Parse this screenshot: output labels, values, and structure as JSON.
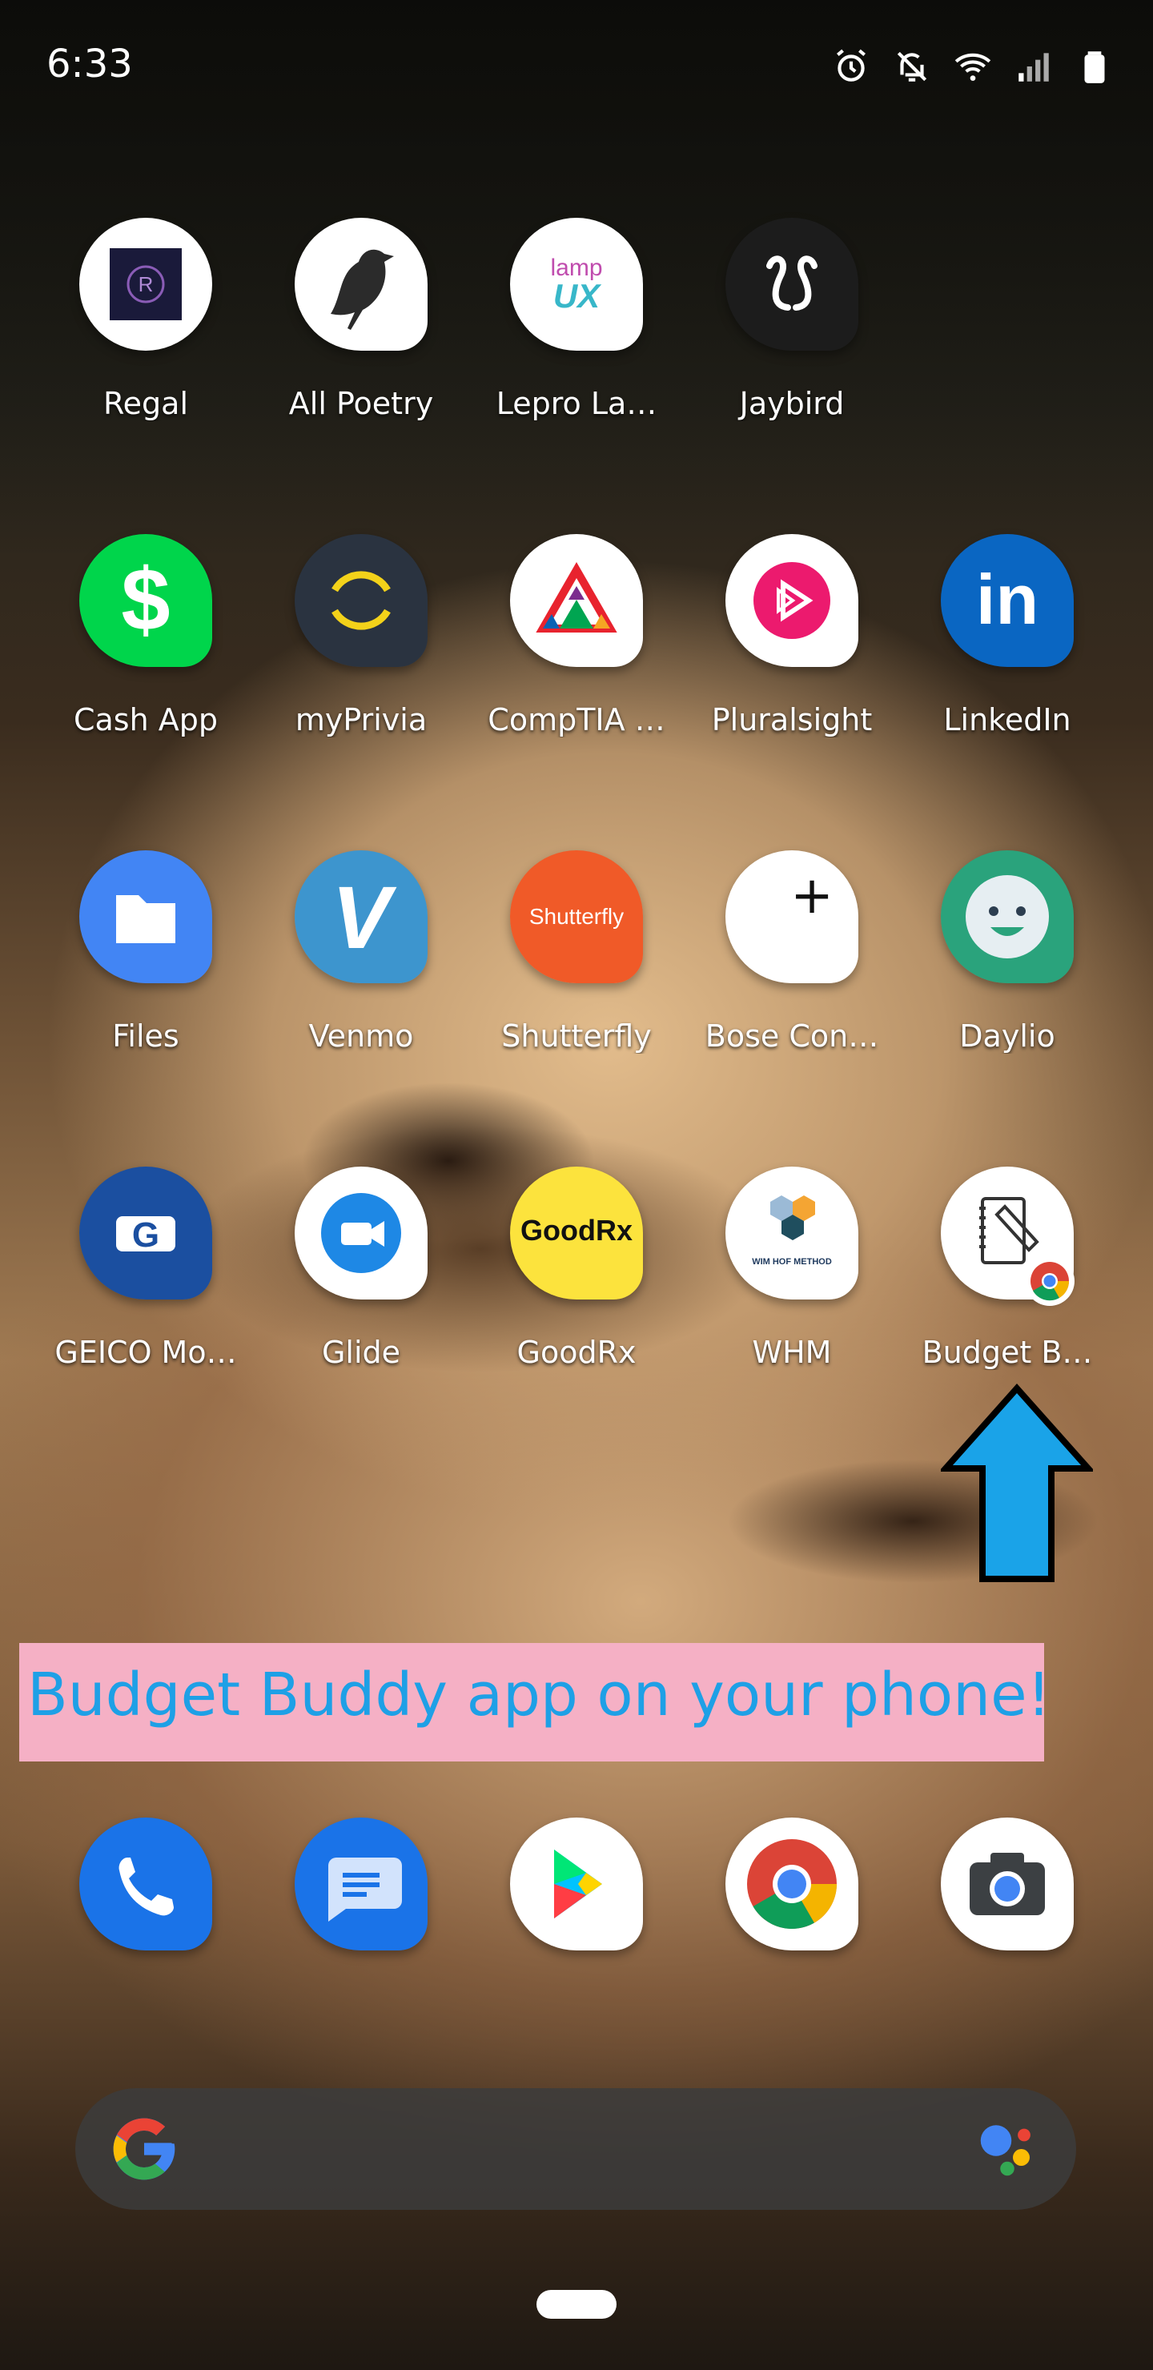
{
  "status_bar": {
    "time": "6:33",
    "icons": [
      "alarm-icon",
      "notifications-off-icon",
      "wifi-icon",
      "signal-icon",
      "battery-icon"
    ]
  },
  "apps": {
    "regal": "Regal",
    "all_poetry": "All Poetry",
    "lepro": "Lepro La…",
    "jaybird": "Jaybird",
    "cash_app": "Cash App",
    "myprivia": "myPrivia",
    "comptia": "CompTIA …",
    "pluralsight": "Pluralsight",
    "linkedin": "LinkedIn",
    "files": "Files",
    "venmo": "Venmo",
    "shutterfly": "Shutterfly",
    "bose": "Bose Con…",
    "daylio": "Daylio",
    "geico": "GEICO Mo…",
    "glide": "Glide",
    "goodrx": "GoodRx",
    "whm": "WHM",
    "budget": "Budget B…"
  },
  "icon_text": {
    "regal_letter": "R",
    "lamp": "lamp",
    "ux": "UX",
    "cash": "$",
    "linkedin": "in",
    "venmo": "V",
    "shutterfly": "Shutterfly",
    "bose": "+",
    "geico": "G",
    "goodrx": "GoodRx",
    "whm": "WIM HOF METHOD"
  },
  "banner": {
    "text": "Budget Buddy app on your phone!"
  },
  "dock": [
    "phone-icon",
    "messages-icon",
    "play-store-icon",
    "chrome-icon",
    "camera-icon"
  ],
  "search": {
    "left_icon": "google-icon",
    "right_icon": "assistant-icon"
  },
  "colors": {
    "banner_bg": "#f5b0c5",
    "banner_text": "#1ea0e6",
    "arrow": "#1aa3e8"
  }
}
